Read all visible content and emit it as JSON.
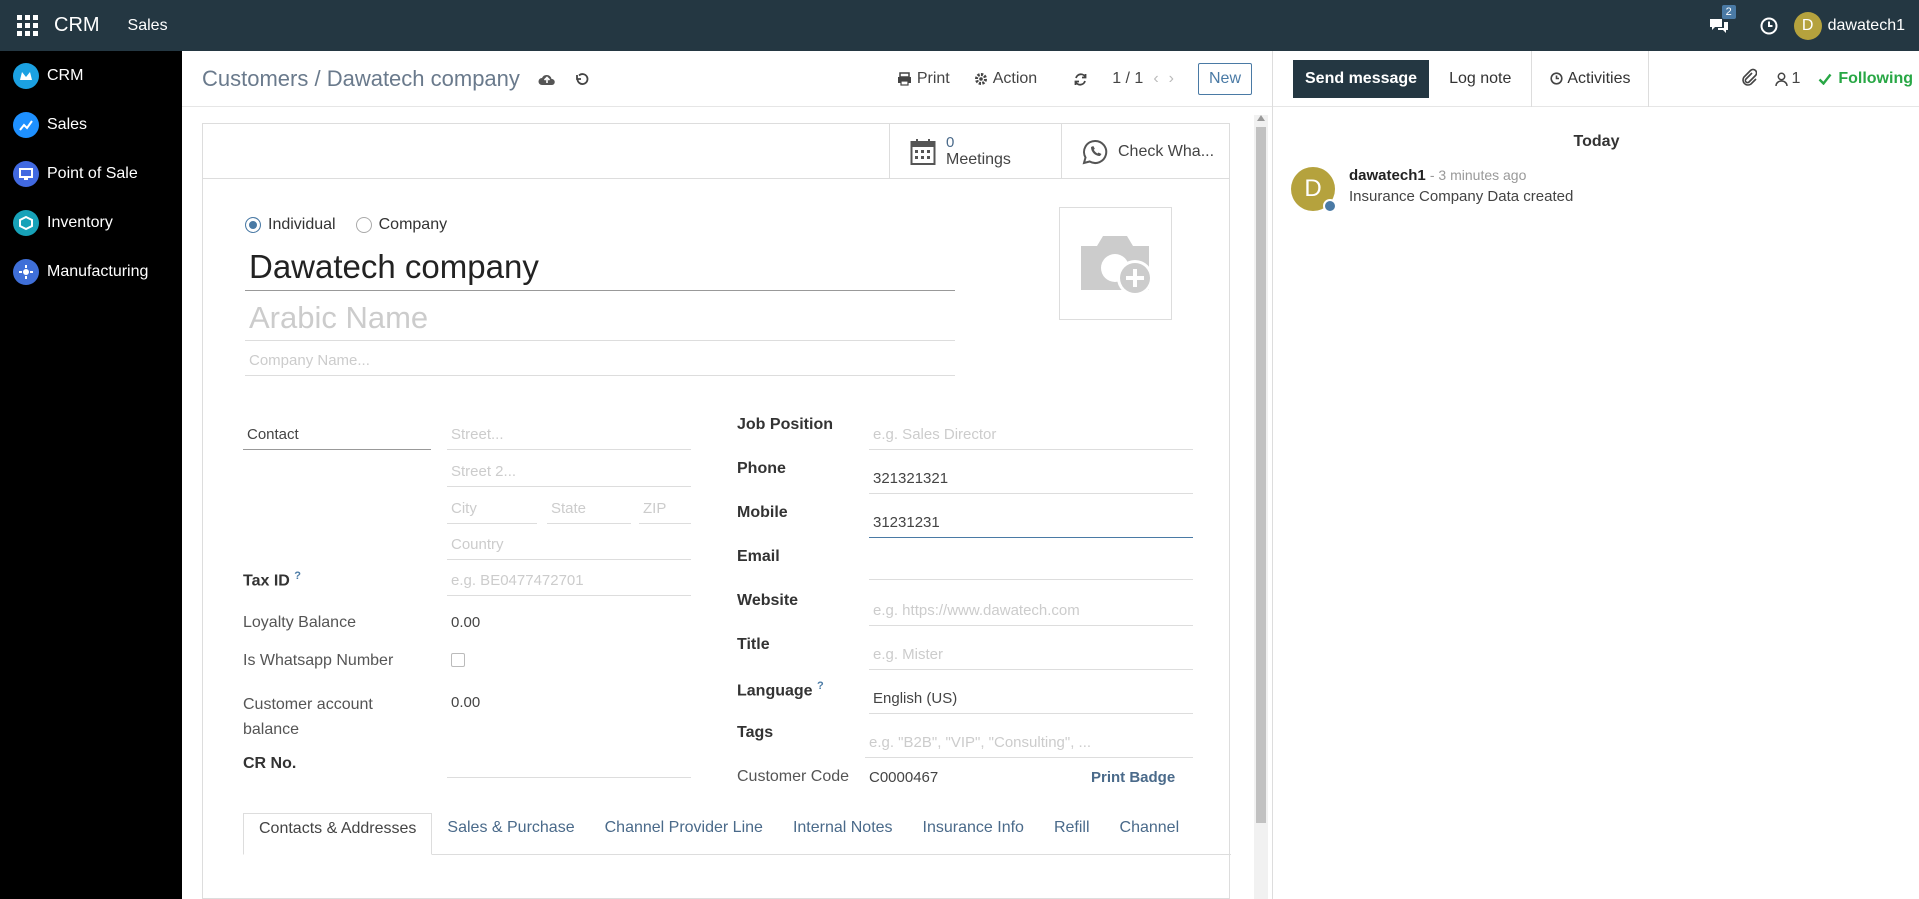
{
  "topbar": {
    "brand": "CRM",
    "menu": "Sales",
    "messages_count": "2",
    "user_initial": "D",
    "user_name": "dawatech1"
  },
  "sidebar": {
    "items": [
      {
        "label": "CRM",
        "color": "#1ba1e2"
      },
      {
        "label": "Sales",
        "color": "#1e90ff"
      },
      {
        "label": "Point of Sale",
        "color": "#4169e1"
      },
      {
        "label": "Inventory",
        "color": "#17a2b8"
      },
      {
        "label": "Manufacturing",
        "color": "#3f6fd8"
      }
    ]
  },
  "control_panel": {
    "breadcrumb": "Customers / Dawatech company",
    "print": "Print",
    "action": "Action",
    "pager": "1 / 1",
    "new": "New"
  },
  "smart_buttons": {
    "meetings_count": "0",
    "meetings_label": "Meetings",
    "whatsapp_label": "Check Wha..."
  },
  "form": {
    "type_individual": "Individual",
    "type_company": "Company",
    "name": "Dawatech company",
    "arabic_placeholder": "Arabic Name",
    "company_placeholder": "Company Name...",
    "contact": "Contact",
    "street_placeholder": "Street...",
    "street2_placeholder": "Street 2...",
    "city_placeholder": "City",
    "state_placeholder": "State",
    "zip_placeholder": "ZIP",
    "country_placeholder": "Country",
    "tax_id_label": "Tax ID",
    "tax_id_placeholder": "e.g. BE0477472701",
    "loyalty_label": "Loyalty Balance",
    "loyalty_value": "0.00",
    "whatsapp_label": "Is Whatsapp Number",
    "customer_balance_label": "Customer account balance",
    "customer_balance_value": "0.00",
    "cr_label": "CR No.",
    "job_label": "Job Position",
    "job_placeholder": "e.g. Sales Director",
    "phone_label": "Phone",
    "phone_value": "321321321",
    "mobile_label": "Mobile",
    "mobile_value": "31231231",
    "email_label": "Email",
    "website_label": "Website",
    "website_placeholder": "e.g. https://www.dawatech.com",
    "title_label": "Title",
    "title_placeholder": "e.g. Mister",
    "language_label": "Language",
    "language_value": "English (US)",
    "tags_label": "Tags",
    "tags_placeholder": "e.g. \"B2B\", \"VIP\", \"Consulting\", ...",
    "customer_code_label": "Customer Code",
    "customer_code_value": "C0000467",
    "print_badge": "Print Badge",
    "help_mark": "?"
  },
  "tabs": [
    {
      "label": "Contacts & Addresses"
    },
    {
      "label": "Sales & Purchase"
    },
    {
      "label": "Channel Provider Line"
    },
    {
      "label": "Internal Notes"
    },
    {
      "label": "Insurance Info"
    },
    {
      "label": "Refill"
    },
    {
      "label": "Channel"
    }
  ],
  "chatter": {
    "send_message": "Send message",
    "log_note": "Log note",
    "activities": "Activities",
    "followers_count": "1",
    "following": "Following",
    "today": "Today",
    "author": "dawatech1",
    "time": "- 3 minutes ago",
    "body": "Insurance Company Data created",
    "author_initial": "D"
  }
}
